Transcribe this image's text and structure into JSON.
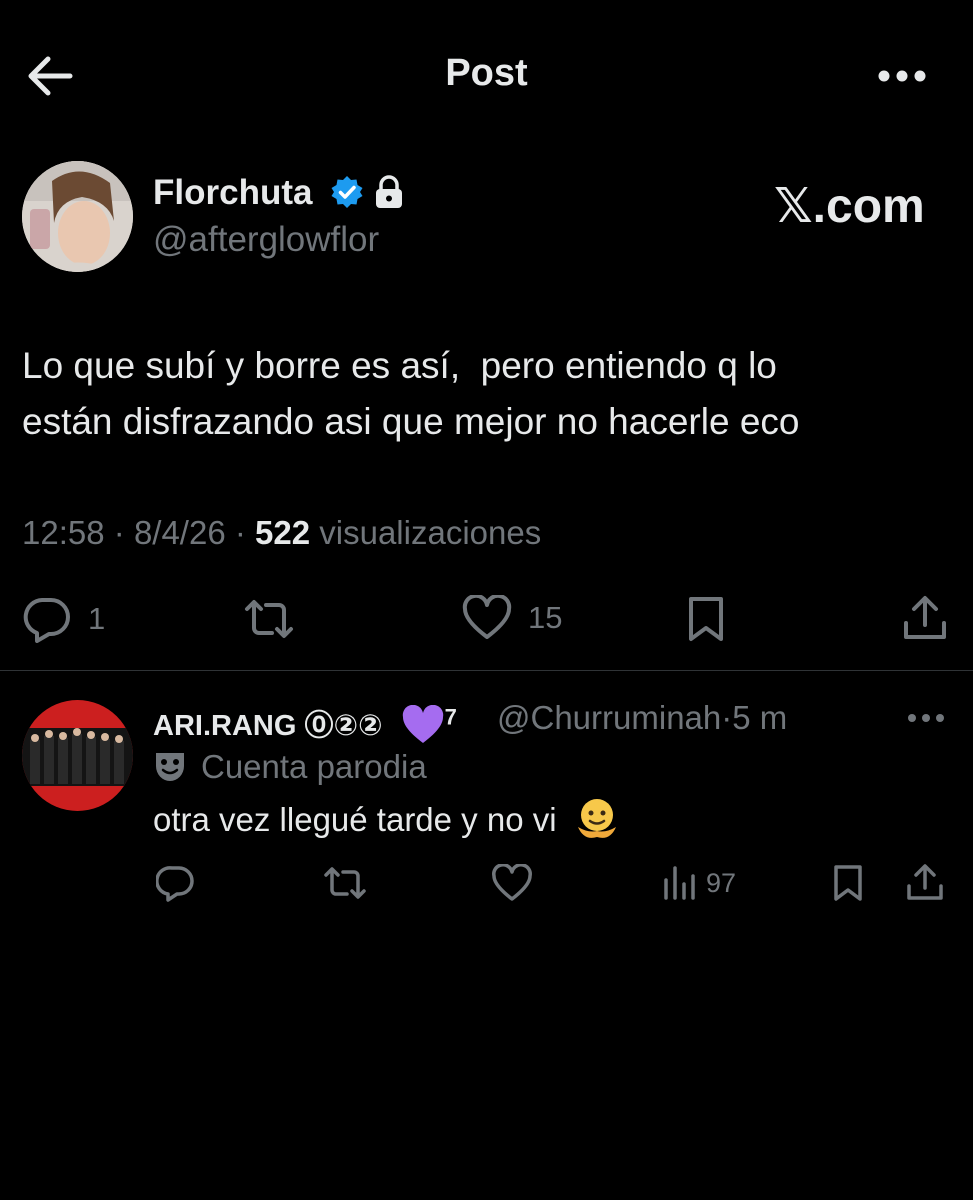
{
  "header": {
    "title": "Post",
    "back_icon": "arrow-left-icon",
    "more_icon": "more-horizontal-icon"
  },
  "post": {
    "author_name": "Florchuta",
    "author_handle": "@afterglowflor",
    "watermark": "𝕏.com",
    "text": "Lo que subí y borre es así,  pero entiendo q lo\nestán disfrazando asi que mejor no hacerle eco",
    "time": "12:58",
    "date": "8/4/26",
    "meta_sep": "·",
    "views_count": "522",
    "views_label": "visualizaciones",
    "replies": "1",
    "likes": "15"
  },
  "reply": {
    "author_name": "ARI.RANG ⓪②②",
    "author_badge_sup": "7",
    "author_handle": "@Churruminah",
    "sep": "·",
    "time": "5 m",
    "parody_label": "Cuenta parodia",
    "text": "otra vez llegué tarde y no vi",
    "views": "97"
  },
  "colors": {
    "background": "#000000",
    "text_primary": "#e7e9ea",
    "text_secondary": "#71767b",
    "verified_blue": "#1d9bf0",
    "divider": "#2f3336",
    "heart_purple": "#a56cf0"
  }
}
